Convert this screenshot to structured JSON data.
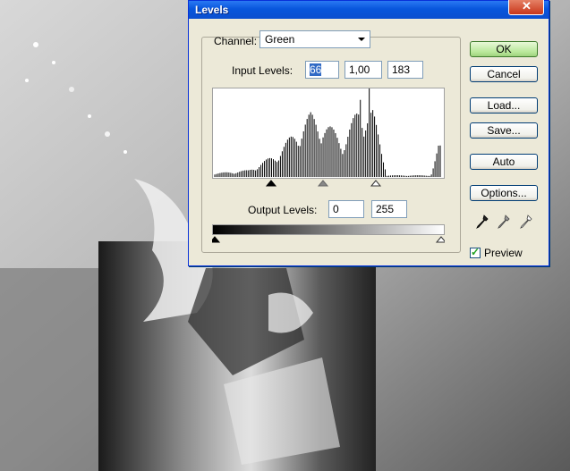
{
  "dialog": {
    "title": "Levels",
    "channel_label": "Channel:",
    "channel_value": "Green",
    "input_levels_label": "Input Levels:",
    "input_black": "66",
    "input_gamma": "1,00",
    "input_white": "183",
    "output_levels_label": "Output Levels:",
    "output_black": "0",
    "output_white": "255"
  },
  "buttons": {
    "ok": "OK",
    "cancel": "Cancel",
    "load": "Load...",
    "save": "Save...",
    "auto": "Auto",
    "options": "Options..."
  },
  "preview": {
    "label": "Preview",
    "checked": true
  },
  "icons": [
    "close-icon",
    "dropdown-arrow-icon",
    "black-eyedropper-icon",
    "gray-eyedropper-icon",
    "white-eyedropper-icon"
  ]
}
